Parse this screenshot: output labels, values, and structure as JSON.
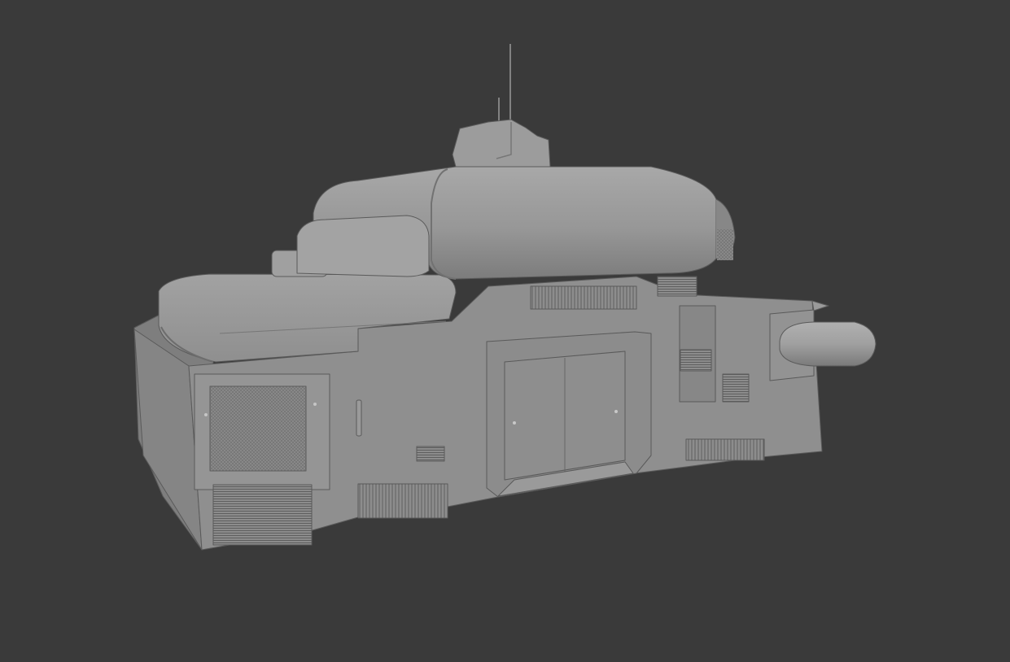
{
  "viewport": {
    "background_color": "#3a3a3a"
  },
  "model": {
    "shading": "solid-gray",
    "base_color": "#8e8e8e",
    "light_color": "#a3a3a3",
    "highlight_color": "#b4b4b4",
    "shadow_color": "#6b6b6b",
    "edge_color": "#555555",
    "vent_color": "#7a7a7a"
  }
}
